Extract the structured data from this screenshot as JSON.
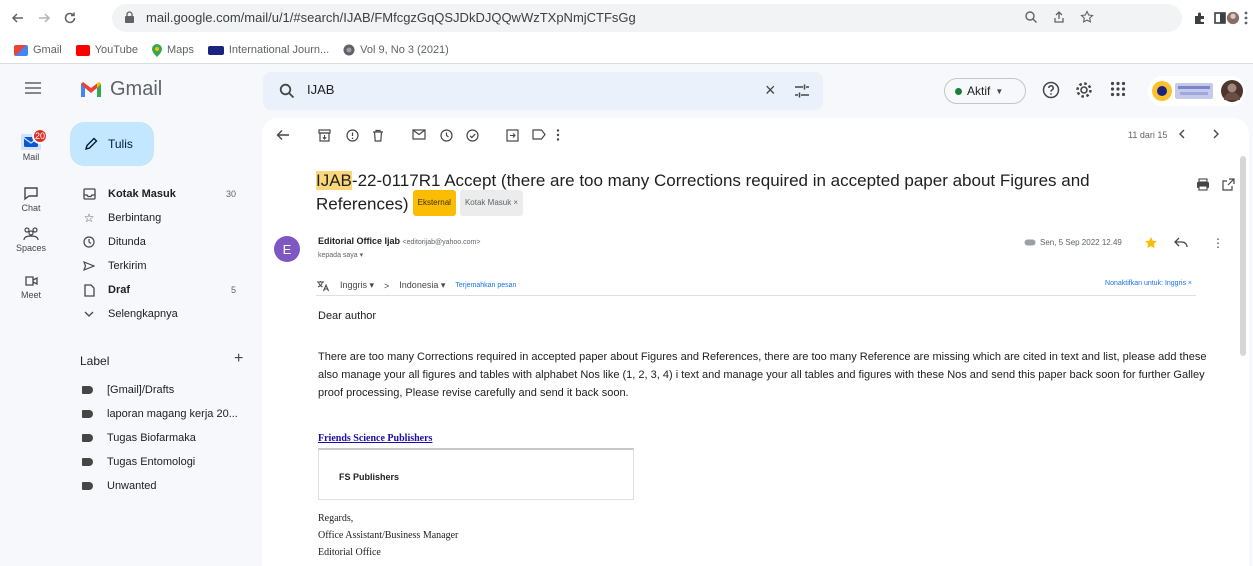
{
  "browser": {
    "url": "mail.google.com/mail/u/1/#search/IJAB/FMfcgzGqQSJDkDJQQwWzTXpNmjCTFsGg",
    "bookmarks": [
      {
        "label": "Gmail",
        "color": "#ea4335"
      },
      {
        "label": "YouTube",
        "color": "#ff0000"
      },
      {
        "label": "Maps",
        "color": "#34a853"
      },
      {
        "label": "International Journ...",
        "color": "#1a237e"
      },
      {
        "label": "Vol 9, No 3 (2021)",
        "color": "#5f6368"
      }
    ]
  },
  "header": {
    "app_name": "Gmail",
    "search_value": "IJAB",
    "status_label": "Aktif",
    "status_color": "#188038"
  },
  "rail": {
    "items": [
      {
        "label": "Mail",
        "icon": "mail-icon"
      },
      {
        "label": "Chat",
        "icon": "chat-icon"
      },
      {
        "label": "Spaces",
        "icon": "spaces-icon"
      },
      {
        "label": "Meet",
        "icon": "meet-icon"
      }
    ],
    "mail_badge": "20"
  },
  "sidebar": {
    "compose_label": "Tulis",
    "items": [
      {
        "label": "Kotak Masuk",
        "count": "30",
        "icon": "inbox-icon",
        "bold": true
      },
      {
        "label": "Berbintang",
        "count": "",
        "icon": "star-icon",
        "bold": false
      },
      {
        "label": "Ditunda",
        "count": "",
        "icon": "clock-icon",
        "bold": false
      },
      {
        "label": "Terkirim",
        "count": "",
        "icon": "send-icon",
        "bold": false
      },
      {
        "label": "Draf",
        "count": "5",
        "icon": "draft-icon",
        "bold": true
      },
      {
        "label": "Selengkapnya",
        "count": "",
        "icon": "chevron-down-icon",
        "bold": false
      }
    ],
    "label_heading": "Label",
    "labels": [
      "[Gmail]/Drafts",
      "laporan magang kerja 20...",
      "Tugas Biofarmaka",
      "Tugas Entomologi",
      "Unwanted"
    ]
  },
  "message": {
    "pager": "11 dari 15",
    "subject_highlight": "IJAB",
    "subject_rest": "-22-0117R1 Accept (there are too many Corrections required in accepted paper about Figures and References)",
    "chip_external": "Eksternal",
    "chip_inbox": "Kotak Masuk ×",
    "sender_initial": "E",
    "sender_name": "Editorial Office Ijab",
    "sender_email": "<editorijab@yahoo.com>",
    "recipient": "kepada saya ▾",
    "date": "Sen, 5 Sep 2022 12.49",
    "translate_from": "Inggris ▾",
    "translate_arrow": ">",
    "translate_to": "Indonesia ▾",
    "translate_link": "Terjemahkan pesan",
    "translate_off": "Nonaktifkan untuk: Inggris ×",
    "greeting": "Dear author",
    "body": "There are too many Corrections required in accepted paper about Figures and References, there are too many Reference are missing which are cited in text and list, please add these also manage your all figures and tables with alphabet Nos like (1, 2, 3, 4) i text and manage your all tables and figures with these Nos and send this paper back soon for further Galley proof processing, Please revise carefully and send it back soon.",
    "signature_link": "Friends Science Publishers",
    "signature_box": "FS Publishers",
    "regards": [
      "Regards,",
      "Office Assistant/Business Manager",
      "Editorial Office"
    ]
  }
}
